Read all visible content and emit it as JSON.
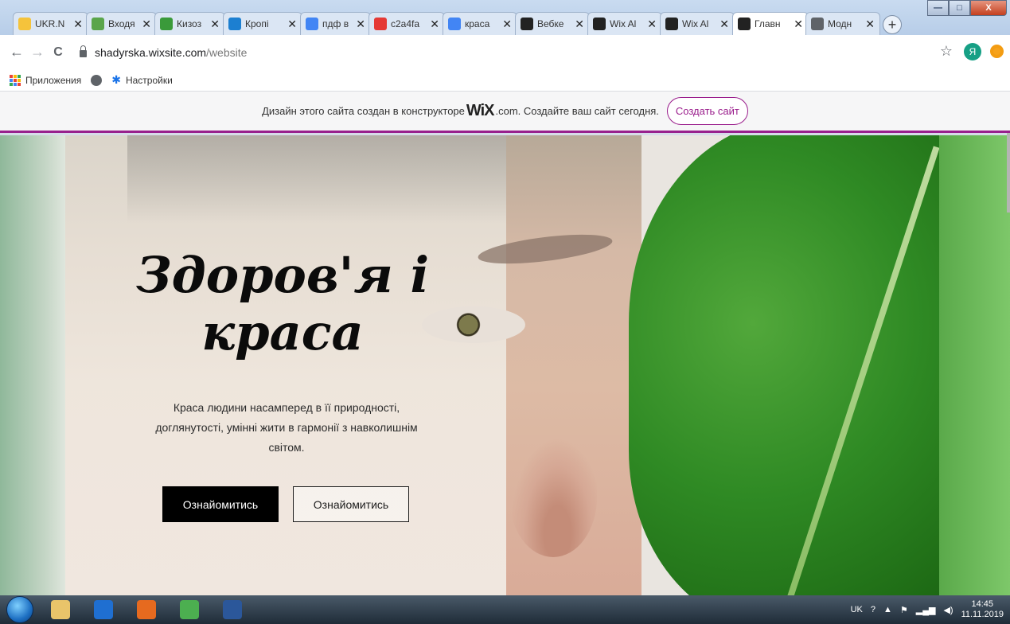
{
  "tabs": [
    {
      "label": "UKR.N",
      "icon": "ukrnet-icon",
      "color": "#f5c33b"
    },
    {
      "label": "Входя",
      "icon": "mail-icon",
      "color": "#5aa54a"
    },
    {
      "label": "Кизоз",
      "icon": "photo-icon",
      "color": "#3a9a3a"
    },
    {
      "label": "Кропі",
      "icon": "circle-app-icon",
      "color": "#1c7fd1"
    },
    {
      "label": "пдф в",
      "icon": "google-icon",
      "color": "#4285f4"
    },
    {
      "label": "c2a4fa",
      "icon": "bars-icon",
      "color": "#e53935"
    },
    {
      "label": "краса",
      "icon": "google-icon",
      "color": "#4285f4"
    },
    {
      "label": "Вебке",
      "icon": "wix-icon",
      "color": "#222222"
    },
    {
      "label": "Wix Al",
      "icon": "wix-icon",
      "color": "#222222"
    },
    {
      "label": "Wix Al",
      "icon": "wix-icon",
      "color": "#222222"
    },
    {
      "label": "Главн",
      "icon": "wix-icon",
      "color": "#222222",
      "active": true
    },
    {
      "label": "Модн",
      "icon": "globe-icon",
      "color": "#5f6368"
    }
  ],
  "tab_close_glyph": "✕",
  "new_tab_glyph": "+",
  "window_buttons": {
    "minimize": "—",
    "maximize": "□",
    "close": "X"
  },
  "address_bar": {
    "back": "←",
    "forward": "→",
    "reload": "C",
    "url_host": "shadyrska.wixsite.com",
    "url_path": "/website",
    "star": "☆",
    "profile_initial": "Я"
  },
  "bookmarks": [
    {
      "label": "Приложения",
      "icon": "apps-grid-icon"
    },
    {
      "label": "",
      "icon": "globe-icon"
    },
    {
      "label": "Настройки",
      "icon": "gear-icon"
    }
  ],
  "wix_banner": {
    "text_before": "Дизайн этого сайта создан в конструкторе",
    "logo": "WiX",
    "text_after": ".com. Создайте ваш сайт сегодня.",
    "button": "Создать сайт",
    "accent": "#98208d"
  },
  "hero": {
    "title_line1": "Здоров'я і",
    "title_line2": "краса",
    "text": "Краса людини насамперед в її природності, доглянутості, умінні жити в гармонії з навколишнім світом.",
    "button_primary": "Ознайомитись",
    "button_secondary": "Ознайомитись"
  },
  "taskbar": {
    "apps": [
      {
        "name": "file-explorer-icon",
        "color": "#e9c46a"
      },
      {
        "name": "media-player-icon",
        "color": "#1f6fd1"
      },
      {
        "name": "firefox-icon",
        "color": "#e66a1f"
      },
      {
        "name": "chrome-icon",
        "color": "#4caf50"
      },
      {
        "name": "word-icon",
        "color": "#2b579a"
      }
    ],
    "language": "UK",
    "time": "14:45",
    "date": "11.11.2019"
  }
}
